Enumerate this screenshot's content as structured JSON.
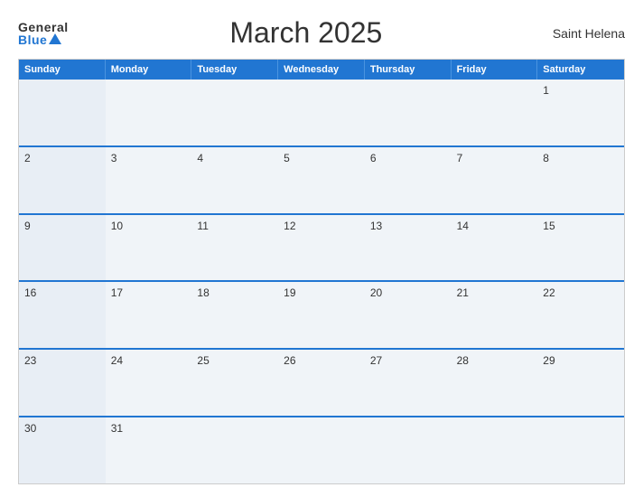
{
  "header": {
    "logo_general": "General",
    "logo_blue": "Blue",
    "title": "March 2025",
    "location": "Saint Helena"
  },
  "days": [
    "Sunday",
    "Monday",
    "Tuesday",
    "Wednesday",
    "Thursday",
    "Friday",
    "Saturday"
  ],
  "weeks": [
    [
      {
        "num": "",
        "empty": true
      },
      {
        "num": "",
        "empty": true
      },
      {
        "num": "",
        "empty": true
      },
      {
        "num": "",
        "empty": true
      },
      {
        "num": "",
        "empty": true
      },
      {
        "num": "",
        "empty": true
      },
      {
        "num": "1"
      }
    ],
    [
      {
        "num": "2"
      },
      {
        "num": "3"
      },
      {
        "num": "4"
      },
      {
        "num": "5"
      },
      {
        "num": "6"
      },
      {
        "num": "7"
      },
      {
        "num": "8"
      }
    ],
    [
      {
        "num": "9"
      },
      {
        "num": "10"
      },
      {
        "num": "11"
      },
      {
        "num": "12"
      },
      {
        "num": "13"
      },
      {
        "num": "14"
      },
      {
        "num": "15"
      }
    ],
    [
      {
        "num": "16"
      },
      {
        "num": "17"
      },
      {
        "num": "18"
      },
      {
        "num": "19"
      },
      {
        "num": "20"
      },
      {
        "num": "21"
      },
      {
        "num": "22"
      }
    ],
    [
      {
        "num": "23"
      },
      {
        "num": "24"
      },
      {
        "num": "25"
      },
      {
        "num": "26"
      },
      {
        "num": "27"
      },
      {
        "num": "28"
      },
      {
        "num": "29"
      }
    ],
    [
      {
        "num": "30"
      },
      {
        "num": "31"
      },
      {
        "num": "",
        "empty": true
      },
      {
        "num": "",
        "empty": true
      },
      {
        "num": "",
        "empty": true
      },
      {
        "num": "",
        "empty": true
      },
      {
        "num": "",
        "empty": true
      }
    ]
  ]
}
